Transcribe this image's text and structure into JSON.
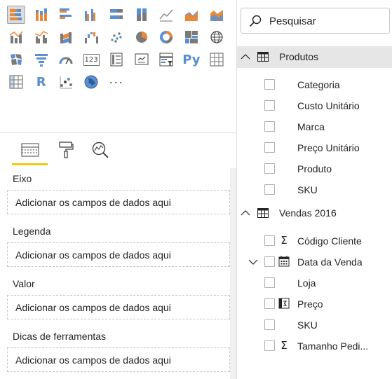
{
  "visualizations": {
    "gallery": [
      {
        "id": "stacked-bar-chart-icon",
        "selected": true
      },
      {
        "id": "stacked-column-chart-icon"
      },
      {
        "id": "clustered-bar-chart-icon"
      },
      {
        "id": "clustered-column-chart-icon"
      },
      {
        "id": "100-stacked-bar-chart-icon"
      },
      {
        "id": "100-stacked-column-chart-icon"
      },
      {
        "id": "line-chart-icon"
      },
      {
        "id": "area-chart-icon"
      },
      {
        "id": "stacked-area-chart-icon"
      },
      {
        "id": "line-and-stacked-column-chart-icon"
      },
      {
        "id": "line-and-clustered-column-chart-icon"
      },
      {
        "id": "ribbon-chart-icon"
      },
      {
        "id": "waterfall-chart-icon"
      },
      {
        "id": "scatter-chart-icon"
      },
      {
        "id": "pie-chart-icon"
      },
      {
        "id": "donut-chart-icon"
      },
      {
        "id": "treemap-icon"
      },
      {
        "id": "map-icon"
      },
      {
        "id": "filled-map-icon"
      },
      {
        "id": "funnel-icon"
      },
      {
        "id": "gauge-icon"
      },
      {
        "id": "card-icon",
        "text": "123"
      },
      {
        "id": "multi-row-card-icon"
      },
      {
        "id": "kpi-icon"
      },
      {
        "id": "slicer-icon"
      },
      {
        "id": "python-visual-icon",
        "text": "Py"
      },
      {
        "id": "table-icon"
      },
      {
        "id": "matrix-icon"
      },
      {
        "id": "r-visual-icon",
        "text": "R"
      },
      {
        "id": "key-influencers-icon"
      },
      {
        "id": "arcgis-map-icon"
      },
      {
        "id": "more-visuals-icon",
        "text": "···"
      }
    ],
    "tabs": [
      {
        "id": "fields-tab-icon",
        "active": true
      },
      {
        "id": "format-paint-roller-icon"
      },
      {
        "id": "analytics-magnifier-icon"
      }
    ],
    "wells": [
      {
        "label": "Eixo",
        "placeholder": "Adicionar os campos de dados aqui"
      },
      {
        "label": "Legenda",
        "placeholder": "Adicionar os campos de dados aqui"
      },
      {
        "label": "Valor",
        "placeholder": "Adicionar os campos de dados aqui"
      },
      {
        "label": "Dicas de ferramentas",
        "placeholder": "Adicionar os campos de dados aqui"
      }
    ]
  },
  "fields": {
    "search": {
      "placeholder": "Pesquisar"
    },
    "tables": [
      {
        "name": "Produtos",
        "expanded": true,
        "fields": [
          {
            "name": "Categoria",
            "icon": ""
          },
          {
            "name": "Custo Unitário",
            "icon": ""
          },
          {
            "name": "Marca",
            "icon": ""
          },
          {
            "name": "Preço Unitário",
            "icon": ""
          },
          {
            "name": "Produto",
            "icon": ""
          },
          {
            "name": "SKU",
            "icon": ""
          }
        ]
      },
      {
        "name": "Vendas 2016",
        "expanded": true,
        "fields": [
          {
            "name": "Código Cliente",
            "icon": "sigma-icon"
          },
          {
            "name": "Data da Venda",
            "icon": "calendar-icon",
            "hierarchy": true
          },
          {
            "name": "Loja",
            "icon": ""
          },
          {
            "name": "Preço",
            "icon": "calculated-column-icon"
          },
          {
            "name": "SKU",
            "icon": ""
          },
          {
            "name": "Tamanho Pedi...",
            "icon": "sigma-icon"
          }
        ]
      }
    ]
  },
  "colors": {
    "accent": "#f2c811",
    "selected_header": "#e6e6e6",
    "icon_blue": "#5b8fd1",
    "icon_orange": "#e8893a"
  }
}
